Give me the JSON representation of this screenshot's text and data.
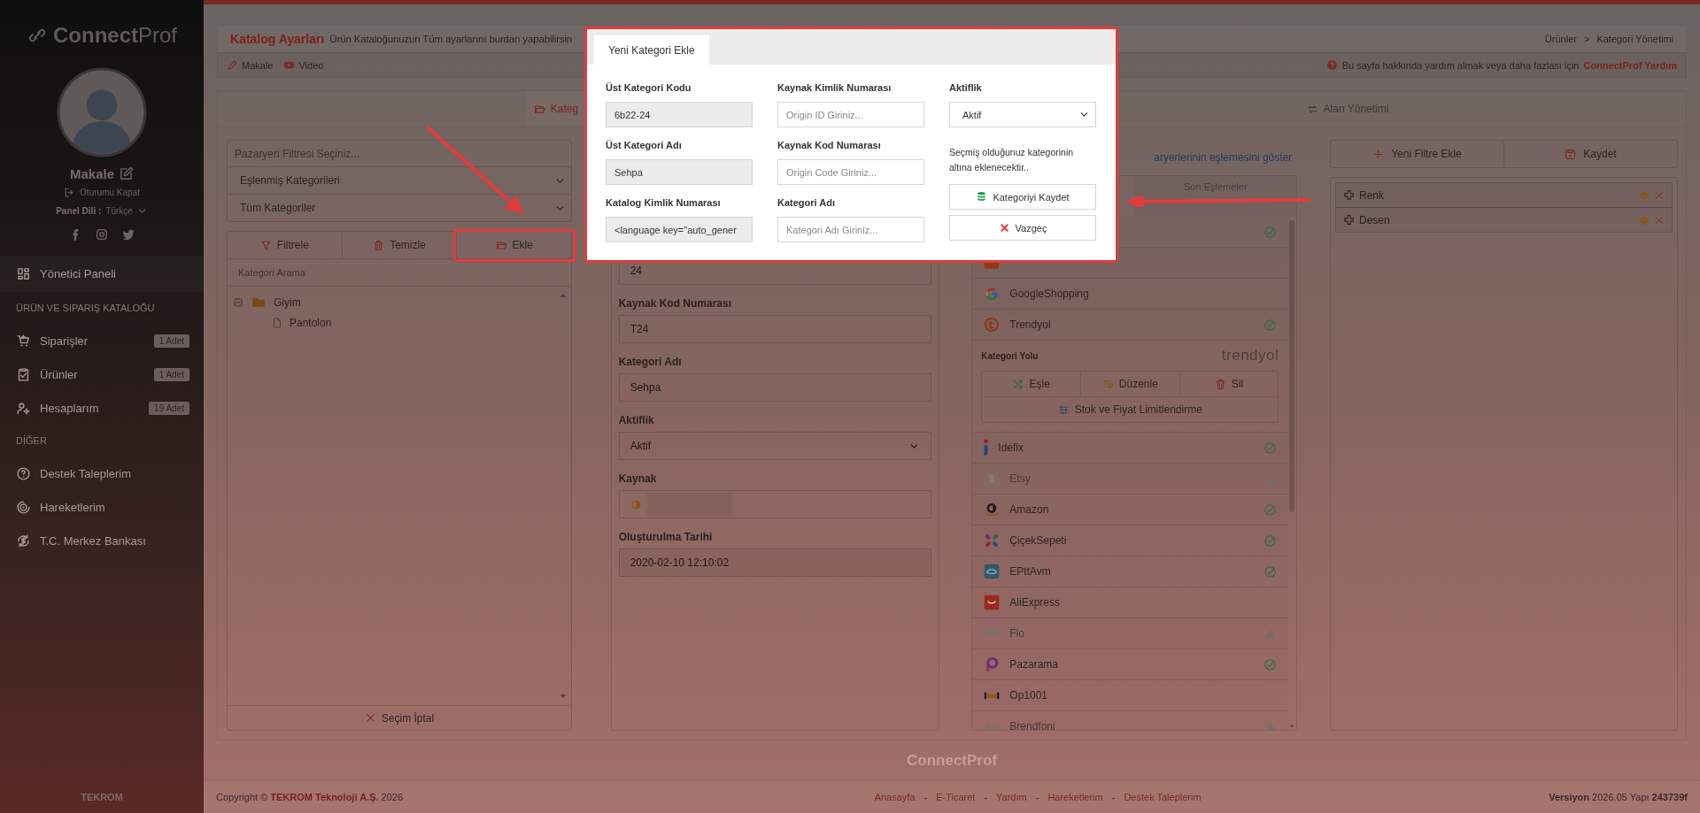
{
  "sidebar": {
    "logo_bold": "Connect",
    "logo_light": "Prof",
    "user_name": "Makale",
    "logout": "Oturumu Kapat",
    "language_label": "Panel Dili :",
    "language": "Türkçe",
    "menu": [
      {
        "kind": "item",
        "label": "Yönetici Paneli",
        "selected": true
      },
      {
        "kind": "section",
        "label": "ÜRÜN VE SIPARIŞ KATALOĞU"
      },
      {
        "kind": "item",
        "label": "Siparişler",
        "badge": "1 Adet",
        "selected": false
      },
      {
        "kind": "item",
        "label": "Ürünler",
        "badge": "1 Adet",
        "selected": false
      },
      {
        "kind": "item",
        "label": "Hesaplarım",
        "badge": "19 Adet",
        "selected": false
      },
      {
        "kind": "section",
        "label": "DİĞER"
      },
      {
        "kind": "item",
        "label": "Destek Taleplerim",
        "selected": false
      },
      {
        "kind": "item",
        "label": "Hareketlerim",
        "selected": false
      },
      {
        "kind": "item",
        "label": "T.C. Merkez Bankası",
        "selected": false
      }
    ],
    "company": "TEKROM"
  },
  "header": {
    "title": "Katalog Ayarları",
    "subtitle": "Ürün Kataloğunuzun Tüm ayarlarını burdan yapabilirsin",
    "breadcrumb": [
      "Ürünler",
      "Kategori Yönetimi"
    ],
    "breadcrumb_separator": ">",
    "links": [
      "Makale",
      "Video"
    ],
    "help_text": "Bu sayfa hakkında yardım almak veya daha fazlası için",
    "help_link": "ConnectProf Yardım"
  },
  "tabs": [
    {
      "label": "Kateg",
      "selected": true
    },
    {
      "label": "Alan Yönetimi",
      "selected": false
    }
  ],
  "left_panel": {
    "market_filter_placeholder": "Pazaryeri Filtresi Seçiniz...",
    "selects": [
      "Eşlenmiş Kategorileri",
      "Tüm Kategoriler"
    ],
    "buttons": [
      {
        "label": "Filtrele",
        "highlighted": false
      },
      {
        "label": "Temizle",
        "highlighted": false
      },
      {
        "label": "Ekle",
        "highlighted": true
      }
    ],
    "search_placeholder": "Kategori Arama",
    "tree": [
      {
        "label": "Giyim",
        "expanded": true,
        "children": [
          {
            "label": "Pantolon"
          }
        ]
      }
    ],
    "cancel_button": "Seçim İptal"
  },
  "detail_form": {
    "fields": [
      {
        "kind": "text",
        "value": "24"
      },
      {
        "kind": "text",
        "label": "Kaynak Kod Numarası",
        "value": "T24"
      },
      {
        "kind": "text",
        "label": "Kategori Adı",
        "value": "Sehpa"
      },
      {
        "kind": "select",
        "label": "Aktiflik",
        "value": "Aktif"
      },
      {
        "kind": "source",
        "label": "Kaynak",
        "redacted": true
      },
      {
        "kind": "readonly",
        "label": "Oluşturulma Tarihi",
        "value": "2020-02-10 12:10:02"
      }
    ]
  },
  "marketplaces": {
    "link": "aryerlerinin eşlemesini göster",
    "tabs": [
      {
        "label": "Son Eşlemeler",
        "selected": false
      }
    ],
    "rows": [
      {
        "mapped": true,
        "warning": false,
        "disabled": false
      },
      {
        "mapped": false,
        "warning": false
      },
      {
        "name": "GoogleShopping",
        "mapped": false,
        "warning": false,
        "disabled": false
      },
      {
        "name": "Trendyol",
        "mapped": true,
        "warning": false,
        "disabled": false,
        "expanded": true,
        "path_label": "Kategori Yolu",
        "logo_text": "trendyol",
        "actions": [
          "Eşle",
          "Düzenle",
          "Sil"
        ],
        "limit_action": "Stok ve Fiyat Limitlendirme"
      },
      {
        "name": "Idefix",
        "mapped": true,
        "warning": false,
        "disabled": false
      },
      {
        "name": "Etsy",
        "mapped": false,
        "warning": true,
        "disabled": true
      },
      {
        "name": "Amazon",
        "mapped": true,
        "warning": false,
        "disabled": false
      },
      {
        "name": "ÇiçekSepeti",
        "mapped": true,
        "warning": false,
        "disabled": false
      },
      {
        "name": "EPttAvm",
        "mapped": true,
        "warning": false,
        "disabled": false
      },
      {
        "name": "AliExpress",
        "mapped": false,
        "warning": false,
        "disabled": false
      },
      {
        "name": "Flo",
        "mapped": false,
        "warning": true,
        "disabled": true
      },
      {
        "name": "Pazarama",
        "mapped": true,
        "warning": false,
        "disabled": false
      },
      {
        "name": "Op1001",
        "mapped": false,
        "warning": false,
        "disabled": false
      },
      {
        "name": "Brendfoni",
        "mapped": false,
        "warning": true,
        "disabled": true
      }
    ]
  },
  "filter_panel": {
    "buttons": [
      "Yeni Filtre Ekle",
      "Kaydet"
    ],
    "filters": [
      "Renk",
      "Desen"
    ]
  },
  "modal": {
    "tab": "Yeni Kategori Ekle",
    "outlined": true,
    "columns": [
      [
        {
          "kind": "readonly",
          "label": "Üst Kategori Kodu",
          "value": "6b22-24"
        },
        {
          "kind": "readonly",
          "label": "Üst Kategori Adı",
          "value": "Sehpa"
        },
        {
          "kind": "readonly",
          "label": "Katalog Kimlik Numarası",
          "value": "<language key=\"auto_gener"
        }
      ],
      [
        {
          "kind": "input",
          "label": "Kaynak Kimlik Numarası",
          "placeholder": "Origin ID Giriniz..."
        },
        {
          "kind": "input",
          "label": "Kaynak Kod Numarası",
          "placeholder": "Origin Code Giriniz..."
        },
        {
          "kind": "input",
          "label": "Kategori Adı",
          "placeholder": "Kategori Adı Giriniz..."
        }
      ]
    ],
    "status_field": {
      "label": "Aktiflik",
      "value": "Aktif"
    },
    "note": "Seçmiş olduğunuz kategorinin altına eklenecektir..",
    "buttons": [
      {
        "kind": "save",
        "label": "Kategoriyi Kaydet",
        "pointed_at": true
      },
      {
        "kind": "cancel",
        "label": "Vazgeç",
        "pointed_at": false
      }
    ]
  },
  "footer": {
    "brand": "ConnectProf",
    "copyright": "Copyright © **TEKROM Teknoloji A.Ş.** 2026",
    "links": [
      "Anasayfa",
      "E-Ticaret",
      "Yardım",
      "Hareketlerim",
      "Destek Taleplerim"
    ],
    "link_separator": "-",
    "version": "**Versiyon** 2026.05 Yapı **243739f**"
  }
}
